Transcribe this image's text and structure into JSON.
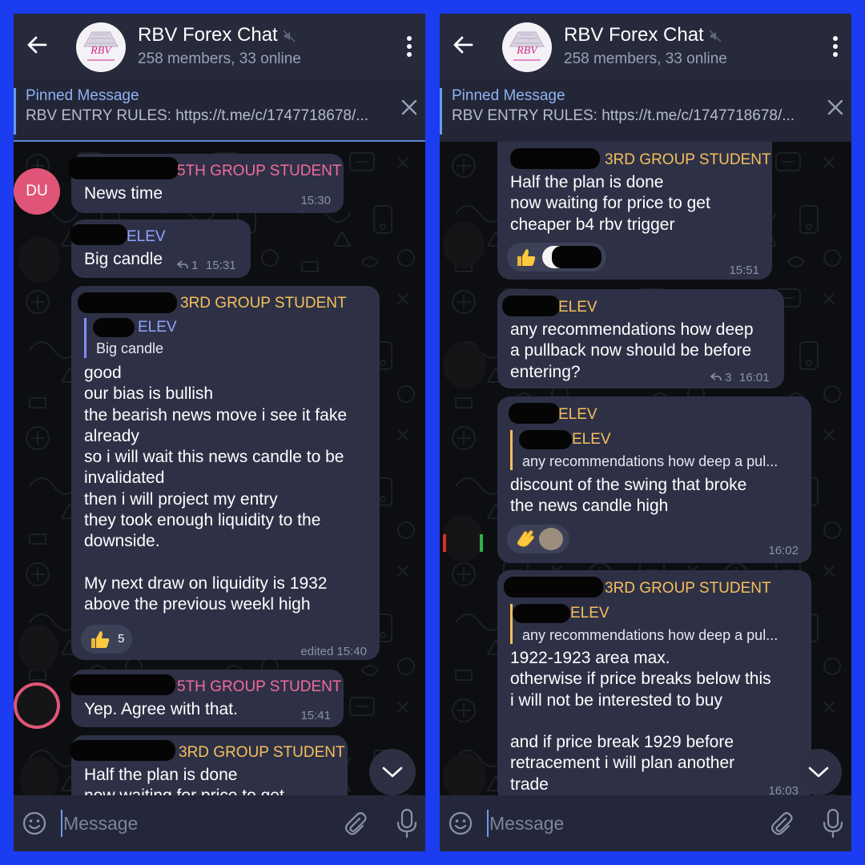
{
  "colors": {
    "frame": "#1b3cf0",
    "header": "#262a3b",
    "bubble": "#2e3146",
    "name_pink": "#f16b9b",
    "name_blue": "#8fa4ff",
    "name_yellow": "#f5c05a",
    "link": "#8fb2f2"
  },
  "chat": {
    "title": "RBV Forex Chat",
    "subtitle": "258 members, 33 online",
    "logo_text": "RBV",
    "logo_icon": "rbv-logo-icon"
  },
  "pinned": {
    "title": "Pinned Message",
    "text": "RBV ENTRY RULES: https://t.me/c/1747718678/..."
  },
  "input": {
    "placeholder": "Message"
  },
  "left": {
    "messages": [
      {
        "avatar": "DU",
        "sender": "5TH GROUP STUDENT",
        "text": "News time",
        "time": "15:30"
      },
      {
        "sender": "ELEV",
        "text": "Big candle",
        "replies": "1",
        "time": "15:31"
      },
      {
        "sender": "3RD GROUP STUDENT",
        "quote_sender": "ELEV",
        "quote_text": "Big candle",
        "text": "good\nour bias is bullish\nthe bearish news move i see it fake\nalready\nso i will wait this news candle to be\ninvalidated\nthen i will project my entry\nthey took enough liquidity to the\ndownside.\n\nMy next draw on liquidity is 1932\nabove the previous weekl high",
        "reaction_icon": "thumbs-up-icon",
        "reaction_count": "5",
        "time": "edited 15:40"
      },
      {
        "sender": "5TH GROUP STUDENT",
        "text": "Yep. Agree with that.",
        "time": "15:41"
      },
      {
        "sender": "3RD GROUP STUDENT",
        "text": "Half the plan is done\nnow waiting for price to get"
      }
    ]
  },
  "right": {
    "messages": [
      {
        "sender": "3RD GROUP STUDENT",
        "text": "Half the plan is done\nnow waiting for price to get\ncheaper b4 rbv trigger",
        "reaction_icon": "thumbs-up-icon",
        "time": "15:51"
      },
      {
        "sender": "ELEV",
        "text": "any recommendations how deep\na pullback now should be before\nentering?",
        "replies": "3",
        "time": "16:01"
      },
      {
        "sender": "ELEV",
        "quote_sender": "ELEV",
        "quote_text": "any recommendations how deep a pul...",
        "text": "discount of the swing that broke\nthe news candle high",
        "reaction_icon": "clapping-hands-icon",
        "time": "16:02"
      },
      {
        "sender": "3RD GROUP STUDENT",
        "quote_sender": "ELEV",
        "quote_text": "any recommendations how deep a pul...",
        "text": "1922-1923 area max.\notherwise if price breaks below this\ni will not be interested to buy\n\nand if price break 1929 before\nretracement i will plan another\ntrade",
        "time": "16:03"
      }
    ]
  }
}
